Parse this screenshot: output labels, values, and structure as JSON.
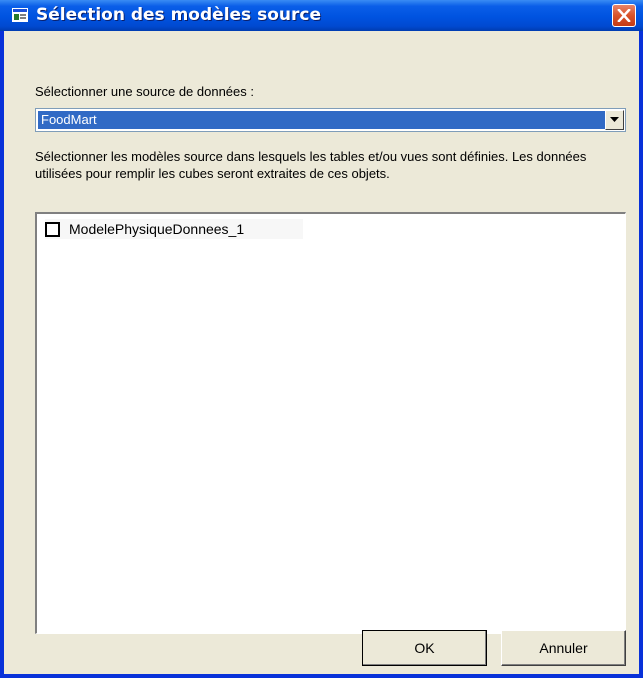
{
  "window": {
    "title": "Sélection des modèles source",
    "icons": {
      "app": "window-app-icon",
      "close": "close-icon"
    }
  },
  "source": {
    "label": "Sélectionner une source de données :",
    "selected_value": "FoodMart",
    "dropdown_icon": "chevron-down-icon"
  },
  "description": "Sélectionner les modèles source dans lesquels les tables et/ou vues sont définies. Les données utilisées pour remplir les cubes seront extraites de ces objets.",
  "models": {
    "items": [
      {
        "label": "ModelePhysiqueDonnees_1",
        "checked": false
      }
    ]
  },
  "buttons": {
    "ok": "OK",
    "cancel": "Annuler"
  },
  "colors": {
    "titlebar": "#0053e0",
    "selection": "#316ac5",
    "dialog_bg": "#ece9d8",
    "close_button": "#d9532a"
  }
}
